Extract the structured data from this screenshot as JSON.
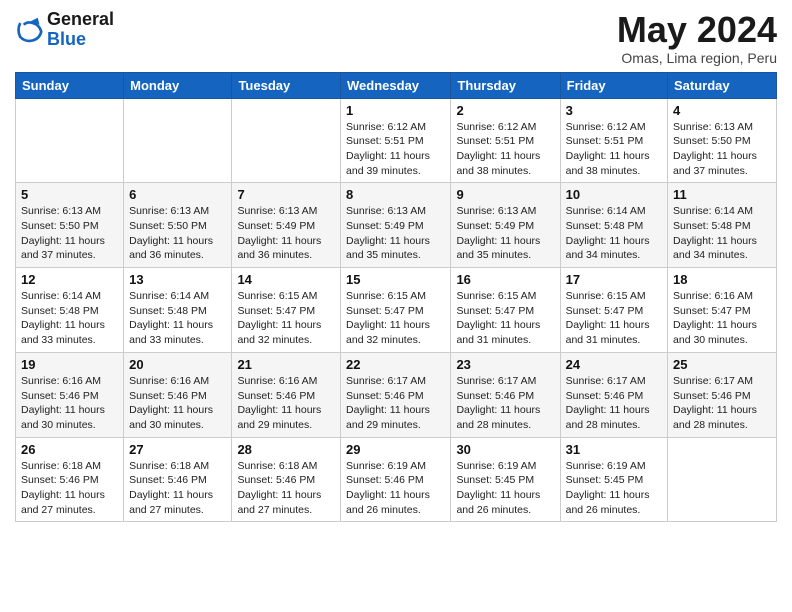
{
  "header": {
    "logo_line1": "General",
    "logo_line2": "Blue",
    "month_title": "May 2024",
    "location": "Omas, Lima region, Peru"
  },
  "weekdays": [
    "Sunday",
    "Monday",
    "Tuesday",
    "Wednesday",
    "Thursday",
    "Friday",
    "Saturday"
  ],
  "weeks": [
    [
      {
        "day": "",
        "info": ""
      },
      {
        "day": "",
        "info": ""
      },
      {
        "day": "",
        "info": ""
      },
      {
        "day": "1",
        "info": "Sunrise: 6:12 AM\nSunset: 5:51 PM\nDaylight: 11 hours\nand 39 minutes."
      },
      {
        "day": "2",
        "info": "Sunrise: 6:12 AM\nSunset: 5:51 PM\nDaylight: 11 hours\nand 38 minutes."
      },
      {
        "day": "3",
        "info": "Sunrise: 6:12 AM\nSunset: 5:51 PM\nDaylight: 11 hours\nand 38 minutes."
      },
      {
        "day": "4",
        "info": "Sunrise: 6:13 AM\nSunset: 5:50 PM\nDaylight: 11 hours\nand 37 minutes."
      }
    ],
    [
      {
        "day": "5",
        "info": "Sunrise: 6:13 AM\nSunset: 5:50 PM\nDaylight: 11 hours\nand 37 minutes."
      },
      {
        "day": "6",
        "info": "Sunrise: 6:13 AM\nSunset: 5:50 PM\nDaylight: 11 hours\nand 36 minutes."
      },
      {
        "day": "7",
        "info": "Sunrise: 6:13 AM\nSunset: 5:49 PM\nDaylight: 11 hours\nand 36 minutes."
      },
      {
        "day": "8",
        "info": "Sunrise: 6:13 AM\nSunset: 5:49 PM\nDaylight: 11 hours\nand 35 minutes."
      },
      {
        "day": "9",
        "info": "Sunrise: 6:13 AM\nSunset: 5:49 PM\nDaylight: 11 hours\nand 35 minutes."
      },
      {
        "day": "10",
        "info": "Sunrise: 6:14 AM\nSunset: 5:48 PM\nDaylight: 11 hours\nand 34 minutes."
      },
      {
        "day": "11",
        "info": "Sunrise: 6:14 AM\nSunset: 5:48 PM\nDaylight: 11 hours\nand 34 minutes."
      }
    ],
    [
      {
        "day": "12",
        "info": "Sunrise: 6:14 AM\nSunset: 5:48 PM\nDaylight: 11 hours\nand 33 minutes."
      },
      {
        "day": "13",
        "info": "Sunrise: 6:14 AM\nSunset: 5:48 PM\nDaylight: 11 hours\nand 33 minutes."
      },
      {
        "day": "14",
        "info": "Sunrise: 6:15 AM\nSunset: 5:47 PM\nDaylight: 11 hours\nand 32 minutes."
      },
      {
        "day": "15",
        "info": "Sunrise: 6:15 AM\nSunset: 5:47 PM\nDaylight: 11 hours\nand 32 minutes."
      },
      {
        "day": "16",
        "info": "Sunrise: 6:15 AM\nSunset: 5:47 PM\nDaylight: 11 hours\nand 31 minutes."
      },
      {
        "day": "17",
        "info": "Sunrise: 6:15 AM\nSunset: 5:47 PM\nDaylight: 11 hours\nand 31 minutes."
      },
      {
        "day": "18",
        "info": "Sunrise: 6:16 AM\nSunset: 5:47 PM\nDaylight: 11 hours\nand 30 minutes."
      }
    ],
    [
      {
        "day": "19",
        "info": "Sunrise: 6:16 AM\nSunset: 5:46 PM\nDaylight: 11 hours\nand 30 minutes."
      },
      {
        "day": "20",
        "info": "Sunrise: 6:16 AM\nSunset: 5:46 PM\nDaylight: 11 hours\nand 30 minutes."
      },
      {
        "day": "21",
        "info": "Sunrise: 6:16 AM\nSunset: 5:46 PM\nDaylight: 11 hours\nand 29 minutes."
      },
      {
        "day": "22",
        "info": "Sunrise: 6:17 AM\nSunset: 5:46 PM\nDaylight: 11 hours\nand 29 minutes."
      },
      {
        "day": "23",
        "info": "Sunrise: 6:17 AM\nSunset: 5:46 PM\nDaylight: 11 hours\nand 28 minutes."
      },
      {
        "day": "24",
        "info": "Sunrise: 6:17 AM\nSunset: 5:46 PM\nDaylight: 11 hours\nand 28 minutes."
      },
      {
        "day": "25",
        "info": "Sunrise: 6:17 AM\nSunset: 5:46 PM\nDaylight: 11 hours\nand 28 minutes."
      }
    ],
    [
      {
        "day": "26",
        "info": "Sunrise: 6:18 AM\nSunset: 5:46 PM\nDaylight: 11 hours\nand 27 minutes."
      },
      {
        "day": "27",
        "info": "Sunrise: 6:18 AM\nSunset: 5:46 PM\nDaylight: 11 hours\nand 27 minutes."
      },
      {
        "day": "28",
        "info": "Sunrise: 6:18 AM\nSunset: 5:46 PM\nDaylight: 11 hours\nand 27 minutes."
      },
      {
        "day": "29",
        "info": "Sunrise: 6:19 AM\nSunset: 5:46 PM\nDaylight: 11 hours\nand 26 minutes."
      },
      {
        "day": "30",
        "info": "Sunrise: 6:19 AM\nSunset: 5:45 PM\nDaylight: 11 hours\nand 26 minutes."
      },
      {
        "day": "31",
        "info": "Sunrise: 6:19 AM\nSunset: 5:45 PM\nDaylight: 11 hours\nand 26 minutes."
      },
      {
        "day": "",
        "info": ""
      }
    ]
  ]
}
